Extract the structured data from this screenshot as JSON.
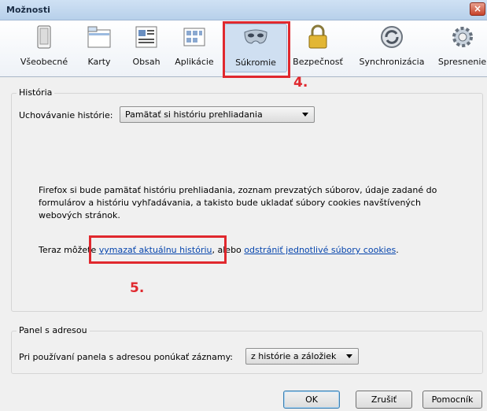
{
  "window": {
    "title": "Možnosti",
    "close_label": "×"
  },
  "tabs": [
    {
      "label": "Všeobecné",
      "icon": "switch-icon"
    },
    {
      "label": "Karty",
      "icon": "tabs-icon"
    },
    {
      "label": "Obsah",
      "icon": "content-icon"
    },
    {
      "label": "Aplikácie",
      "icon": "applications-icon"
    },
    {
      "label": "Súkromie",
      "icon": "mask-icon",
      "active": true
    },
    {
      "label": "Bezpečnosť",
      "icon": "lock-icon"
    },
    {
      "label": "Synchronizácia",
      "icon": "sync-icon"
    },
    {
      "label": "Spresnenie",
      "icon": "gear-icon"
    }
  ],
  "annotations": {
    "step4": "4.",
    "step5": "5.",
    "color": "#e0282e"
  },
  "history": {
    "legend": "História",
    "keep_label": "Uchovávanie histórie:",
    "keep_value": "Pamätať si históriu prehliadania",
    "description": "Firefox si bude pamätať históriu prehliadania, zoznam prevzatých súborov, údaje zadané do formulárov a históriu vyhľadávania, a takisto bude ukladať súbory cookies navštívených webových stránok.",
    "now_prefix": "Teraz môžete ",
    "clear_link": "vymazať aktuálnu históriu",
    "or_text": ", alebo ",
    "cookies_link": "odstrániť jednotlivé súbory cookies",
    "end_text": "."
  },
  "address_bar": {
    "legend": "Panel s adresou",
    "suggest_label": "Pri používaní panela s adresou ponúkať záznamy:",
    "suggest_value": "z histórie a záložiek"
  },
  "buttons": {
    "ok": "OK",
    "cancel": "Zrušiť",
    "help": "Pomocník"
  }
}
